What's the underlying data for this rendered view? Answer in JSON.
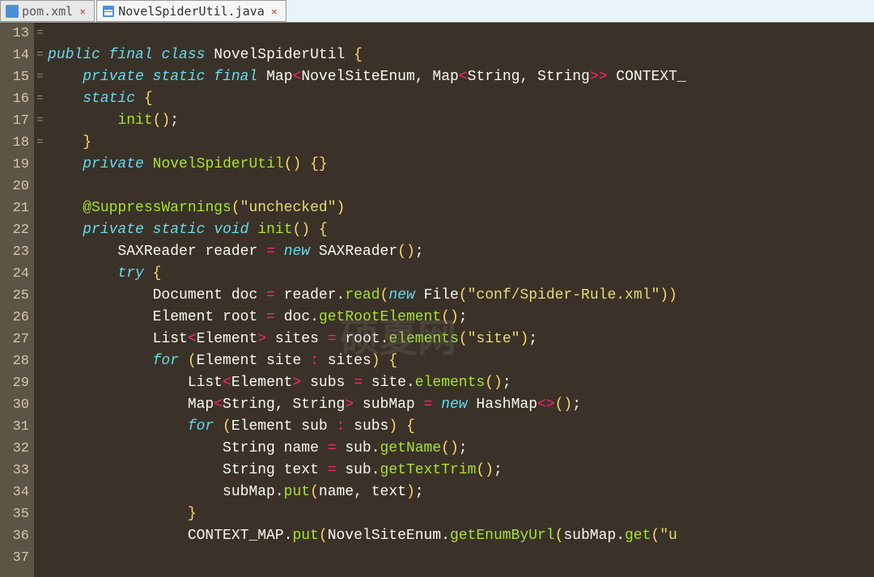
{
  "tabs": [
    {
      "label": "pom.xml",
      "active": false,
      "icon": "xml-file-icon"
    },
    {
      "label": "NovelSpiderUtil.java",
      "active": true,
      "icon": "java-file-icon"
    }
  ],
  "gutter": {
    "start": 13,
    "end": 37,
    "fold_markers": {
      "14": "=",
      "16": "=",
      "22": "=",
      "24": "=",
      "28": "=",
      "31": "="
    }
  },
  "code": {
    "line13": "",
    "line14": {
      "kw1": "public",
      "kw2": "final",
      "kw3": "class",
      "name": "NovelSpiderUtil",
      "brace": "{"
    },
    "line15": {
      "kw1": "private",
      "kw2": "static",
      "kw3": "final",
      "type1": "Map",
      "lt": "<",
      "type2": "NovelSiteEnum",
      "comma": ",",
      "type3": "Map",
      "type4": "String",
      "type5": "String",
      "gt": ">>",
      "name": "CONTEXT_"
    },
    "line16": {
      "kw": "static",
      "brace": "{"
    },
    "line17": {
      "call": "init",
      "paren": "()",
      "semi": ";"
    },
    "line18": {
      "brace": "}"
    },
    "line19": {
      "kw": "private",
      "name": "NovelSpiderUtil",
      "paren": "()",
      "braces": "{}"
    },
    "line20": "",
    "line21": {
      "ann": "@SuppressWarnings",
      "paren_open": "(",
      "str": "\"unchecked\"",
      "paren_close": ")"
    },
    "line22": {
      "kw1": "private",
      "kw2": "static",
      "kw3": "void",
      "name": "init",
      "paren": "()",
      "brace": "{"
    },
    "line23": {
      "type": "SAXReader",
      "var": "reader",
      "op": "=",
      "kw": "new",
      "ctor": "SAXReader",
      "paren": "()",
      "semi": ";"
    },
    "line24": {
      "kw": "try",
      "brace": "{"
    },
    "line25": {
      "type": "Document",
      "var": "doc",
      "op": "=",
      "obj": "reader",
      "dot": ".",
      "method": "read",
      "paren_open": "(",
      "kw": "new",
      "ctor": "File",
      "paren2_open": "(",
      "str": "\"conf/Spider-Rule.xml\"",
      "paren2_close": "))"
    },
    "line26": {
      "type": "Element",
      "var": "root",
      "op": "=",
      "obj": "doc",
      "dot": ".",
      "method": "getRootElement",
      "paren": "()",
      "semi": ";"
    },
    "line27": {
      "type": "List",
      "lt": "<",
      "gen": "Element",
      "gt": ">",
      "var": "sites",
      "op": "=",
      "obj": "root",
      "dot": ".",
      "method": "elements",
      "paren_open": "(",
      "str": "\"site\"",
      "paren_close": ")",
      "semi": ";"
    },
    "line28": {
      "kw": "for",
      "paren_open": "(",
      "type": "Element",
      "var": "site",
      "colon": ":",
      "coll": "sites",
      "paren_close": ")",
      "brace": "{"
    },
    "line29": {
      "type": "List",
      "lt": "<",
      "gen": "Element",
      "gt": ">",
      "var": "subs",
      "op": "=",
      "obj": "site",
      "dot": ".",
      "method": "elements",
      "paren": "()",
      "semi": ";"
    },
    "line30": {
      "type": "Map",
      "lt": "<",
      "gen1": "String",
      "comma": ",",
      "gen2": "String",
      "gt": ">",
      "var": "subMap",
      "op": "=",
      "kw": "new",
      "ctor": "HashMap",
      "diamond": "<>",
      "paren": "()",
      "semi": ";"
    },
    "line31": {
      "kw": "for",
      "paren_open": "(",
      "type": "Element",
      "var": "sub",
      "colon": ":",
      "coll": "subs",
      "paren_close": ")",
      "brace": "{"
    },
    "line32": {
      "type": "String",
      "var": "name",
      "op": "=",
      "obj": "sub",
      "dot": ".",
      "method": "getName",
      "paren": "()",
      "semi": ";"
    },
    "line33": {
      "type": "String",
      "var": "text",
      "op": "=",
      "obj": "sub",
      "dot": ".",
      "method": "getTextTrim",
      "paren": "()",
      "semi": ";"
    },
    "line34": {
      "obj": "subMap",
      "dot": ".",
      "method": "put",
      "paren_open": "(",
      "arg1": "name",
      "comma": ",",
      "arg2": "text",
      "paren_close": ")",
      "semi": ";"
    },
    "line35": {
      "brace": "}"
    },
    "line36": {
      "obj": "CONTEXT_MAP",
      "dot": ".",
      "method": "put",
      "paren_open": "(",
      "type": "NovelSiteEnum",
      "dot2": ".",
      "method2": "getEnumByUrl",
      "paren2_open": "(",
      "obj2": "subMap",
      "dot3": ".",
      "method3": "get",
      "paren3_open": "(",
      "str": "\"u"
    }
  },
  "watermark": "硕夏网"
}
